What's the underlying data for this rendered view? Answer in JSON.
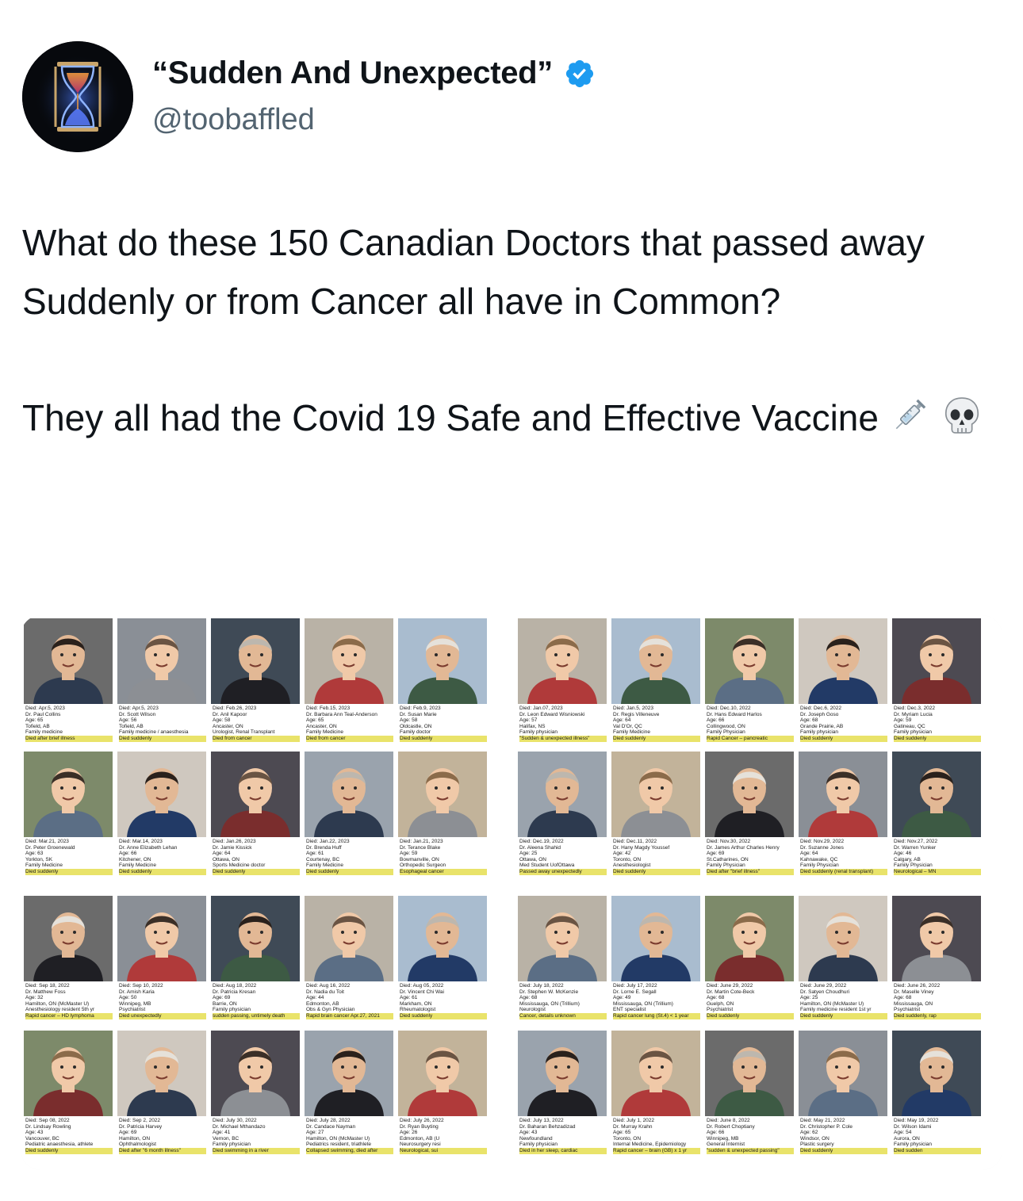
{
  "author": {
    "display_name": "“Sudden And Unexpected”",
    "handle": "@toobaffled",
    "verified": true,
    "avatar_icon": "hourglass-icon"
  },
  "tweet": {
    "paragraph1": "What do these 150 Canadian Doctors that passed away Suddenly or from Cancer all have in Common?",
    "paragraph2": "They all had the Covid 19 Safe and Effective Vaccine",
    "emojis": [
      "syringe-icon",
      "skull-icon"
    ]
  },
  "colors": {
    "verified_badge": "#1d9bf0",
    "handle_text": "#536471",
    "highlight": "#e9e36a"
  },
  "media": {
    "left_panel": [
      {
        "died": "Died: Apr.5, 2023",
        "name": "Dr. Paul Collins",
        "age": "Age: 65",
        "place": "Tofield, AB",
        "specialty": "Family medicine",
        "note": "Died after brief illness"
      },
      {
        "died": "Died: Apr.5, 2023",
        "name": "Dr. Scott Wilson",
        "age": "Age: 56",
        "place": "Tofield, AB",
        "specialty": "Family medicine / anaesthesia",
        "note": "Died suddenly"
      },
      {
        "died": "Died: Feb.26, 2023",
        "name": "Dr. Anil Kapoor",
        "age": "Age: 58",
        "place": "Ancaster, ON",
        "specialty": "Urologist, Renal Transplant",
        "note": "Died from cancer"
      },
      {
        "died": "Died: Feb.15, 2023",
        "name": "Dr. Barbara Ann Teal-Anderson",
        "age": "Age: 65",
        "place": "Ancaster, ON",
        "specialty": "Family Medicine",
        "note": "Died from cancer"
      },
      {
        "died": "Died: Feb.9, 2023",
        "name": "Dr. Susan Marie",
        "age": "Age: 58",
        "place": "Oldcastle, ON",
        "specialty": "Family doctor",
        "note": "Died suddenly"
      },
      {
        "died": "Died: Mar.21, 2023",
        "name": "Dr. Peter Groenewald",
        "age": "Age: 63",
        "place": "Yorkton, SK",
        "specialty": "Family Medicine",
        "note": "Died suddenly"
      },
      {
        "died": "Died: Mar.14, 2023",
        "name": "Dr. Anne Elizabeth Lehan",
        "age": "Age: 66",
        "place": "Kitchener, ON",
        "specialty": "Family Medicine",
        "note": "Died suddenly"
      },
      {
        "died": "Died: Jan.26, 2023",
        "name": "Dr. Jamie Kissick",
        "age": "Age: 64",
        "place": "Ottawa, ON",
        "specialty": "Sports Medicine doctor",
        "note": "Died suddenly"
      },
      {
        "died": "Died: Jan.22, 2023",
        "name": "Dr. Brenda Huff",
        "age": "Age: 61",
        "place": "Courtenay, BC",
        "specialty": "Family Medicine",
        "note": "Died suddenly"
      },
      {
        "died": "Died: Jan.21, 2023",
        "name": "Dr. Terance Blake",
        "age": "Age: 59",
        "place": "Bowmanville, ON",
        "specialty": "Orthopedic Surgeon",
        "note": "Esophageal cancer"
      },
      {
        "died": "Died: Sep 18, 2022",
        "name": "Dr. Matthew Foss",
        "age": "Age: 32",
        "place": "Hamilton, ON (McMaster U)",
        "specialty": "Anesthesiology resident 5th yr",
        "note": "Rapid cancer – HD lymphoma"
      },
      {
        "died": "Died: Sep 10, 2022",
        "name": "Dr. Amish Karia",
        "age": "Age: 50",
        "place": "Winnipeg, MB",
        "specialty": "Psychiatrist",
        "note": "Died unexpectedly"
      },
      {
        "died": "Died: Aug 18, 2022",
        "name": "Dr. Patricia Kresan",
        "age": "Age: 69",
        "place": "Barrie, ON",
        "specialty": "Family physician",
        "note": "sudden passing, untimely death"
      },
      {
        "died": "Died: Aug 16, 2022",
        "name": "Dr. Nadia du Toit",
        "age": "Age: 44",
        "place": "Edmonton, AB",
        "specialty": "Obs & Gyn Physician",
        "note": "Rapid brain cancer Apr.27, 2021"
      },
      {
        "died": "Died: Aug 05, 2022",
        "name": "Dr. Vincent Chi Wai",
        "age": "Age: 61",
        "place": "Markham, ON",
        "specialty": "Rheumatologist",
        "note": "Died suddenly"
      },
      {
        "died": "Died: Sep 08, 2022",
        "name": "Dr. Lindsay Rowling",
        "age": "Age: 43",
        "place": "Vancouver, BC",
        "specialty": "Pediatric anaesthesia, athlete",
        "note": "Died suddenly"
      },
      {
        "died": "Died: Sep 2, 2022",
        "name": "Dr. Patricia Harvey",
        "age": "Age: 69",
        "place": "Hamilton, ON",
        "specialty": "Ophthalmologist",
        "note": "Died after \"6 month illness\""
      },
      {
        "died": "Died: July 30, 2022",
        "name": "Dr. Michael Mthandazo",
        "age": "Age: 41",
        "place": "Vernon, BC",
        "specialty": "Family physician",
        "note": "Died swimming in a river"
      },
      {
        "died": "Died: July 28, 2022",
        "name": "Dr. Candace Nayman",
        "age": "Age: 27",
        "place": "Hamilton, ON (McMaster U)",
        "specialty": "Pediatrics resident, triathlete",
        "note": "Collapsed swimming, died after"
      },
      {
        "died": "Died: July 26, 2022",
        "name": "Dr. Ryan Buyting",
        "age": "Age: 26",
        "place": "Edmonton, AB (U",
        "specialty": "Neurosurgery resi",
        "note": "Neurological, sui"
      }
    ],
    "right_panel": [
      {
        "died": "Died: Jan.07, 2023",
        "name": "Dr. Leon Edward Wisniowski",
        "age": "Age: 57",
        "place": "Halifax, NS",
        "specialty": "Family physician",
        "note": "\"Sudden & unexpected illness\""
      },
      {
        "died": "Died: Jan.5, 2023",
        "name": "Dr. Regis Villeneuve",
        "age": "Age: 64",
        "place": "Val D'Or, QC",
        "specialty": "Family Medicine",
        "note": "Died suddenly"
      },
      {
        "died": "Died: Dec.10, 2022",
        "name": "Dr. Hans Edward Harlos",
        "age": "Age: 66",
        "place": "Collingwood, ON",
        "specialty": "Family Physician",
        "note": "Rapid Cancer – pancreatic"
      },
      {
        "died": "Died: Dec.6, 2022",
        "name": "Dr. Joseph Goso",
        "age": "Age: 68",
        "place": "Grande Prairie, AB",
        "specialty": "Family physician",
        "note": "Died suddenly"
      },
      {
        "died": "Died: Dec.3, 2022",
        "name": "Dr. Myriam Lucia",
        "age": "Age: 59",
        "place": "Gatineau, QC",
        "specialty": "Family physician",
        "note": "Died suddenly"
      },
      {
        "died": "Died: Dec.19, 2022",
        "name": "Dr. Aleena Shahid",
        "age": "Age: 25",
        "place": "Ottawa, ON",
        "specialty": "Med Student UofOttawa",
        "note": "Passed away unexpectedly"
      },
      {
        "died": "Died: Dec.11, 2022",
        "name": "Dr. Hany Magdy Youssef",
        "age": "Age: 42",
        "place": "Toronto, ON",
        "specialty": "Anesthesiologist",
        "note": "Died suddenly"
      },
      {
        "died": "Died: Nov.30, 2022",
        "name": "Dr. James Arthur Charles Henry",
        "age": "Age: 69",
        "place": "St.Catharines, ON",
        "specialty": "Family Physician",
        "note": "Died after \"brief illness\""
      },
      {
        "died": "Died: Nov.29, 2022",
        "name": "Dr. Suzanne Jones",
        "age": "Age: 64",
        "place": "Kahnawake, QC",
        "specialty": "Family Physician",
        "note": "Died suddenly (renal transplant)"
      },
      {
        "died": "Died: Nov.27, 2022",
        "name": "Dr. Warren Yunker",
        "age": "Age: 46",
        "place": "Calgary, AB",
        "specialty": "Family Physician",
        "note": "Neurological – MN"
      },
      {
        "died": "Died: July 18, 2022",
        "name": "Dr. Stephen W. McKenzie",
        "age": "Age: 68",
        "place": "Mississauga, ON (Trillium)",
        "specialty": "Neurologist",
        "note": "Cancer, details unknown"
      },
      {
        "died": "Died: July 17, 2022",
        "name": "Dr. Lorne E. Segall",
        "age": "Age: 49",
        "place": "Mississauga, ON (Trillium)",
        "specialty": "ENT specialist",
        "note": "Rapid cancer lung (St.4) < 1 year"
      },
      {
        "died": "Died: June 29, 2022",
        "name": "Dr. Martin Cote-Beck",
        "age": "Age: 68",
        "place": "Guelph, ON",
        "specialty": "Psychiatrist",
        "note": "Died suddenly"
      },
      {
        "died": "Died: June 29, 2022",
        "name": "Dr. Satyen Choudhuri",
        "age": "Age: 25",
        "place": "Hamilton, ON (McMaster U)",
        "specialty": "Family medicine resident 1st yr",
        "note": "Died suddenly"
      },
      {
        "died": "Died: June 26, 2022",
        "name": "Dr. Maselle Viney",
        "age": "Age: 68",
        "place": "Mississauga, ON",
        "specialty": "Psychiatrist",
        "note": "Died suddenly, rap"
      },
      {
        "died": "Died: July 13, 2022",
        "name": "Dr. Baharan Behzadizad",
        "age": "Age: 43",
        "place": "Newfoundland",
        "specialty": "Family physician",
        "note": "Died in her sleep, cardiac"
      },
      {
        "died": "Died: July 1, 2022",
        "name": "Dr. Murray Krahn",
        "age": "Age: 65",
        "place": "Toronto, ON",
        "specialty": "Internal Medicine, Epidemiology",
        "note": "Rapid cancer – brain (GB) x 1 yr"
      },
      {
        "died": "Died: June 8, 2022",
        "name": "Dr. Robert Choptiany",
        "age": "Age: 66",
        "place": "Winnipeg, MB",
        "specialty": "General Internist",
        "note": "\"sudden & unexpected passing\""
      },
      {
        "died": "Died: May 21, 2022",
        "name": "Dr. Christopher P. Cole",
        "age": "Age: 62",
        "place": "Windsor, ON",
        "specialty": "Plastic surgery",
        "note": "Died suddenly"
      },
      {
        "died": "Died: May 19, 2022",
        "name": "Dr. Wilson Idami",
        "age": "Age: 54",
        "place": "Aurora, ON",
        "specialty": "Family physician",
        "note": "Died sudden"
      }
    ]
  }
}
